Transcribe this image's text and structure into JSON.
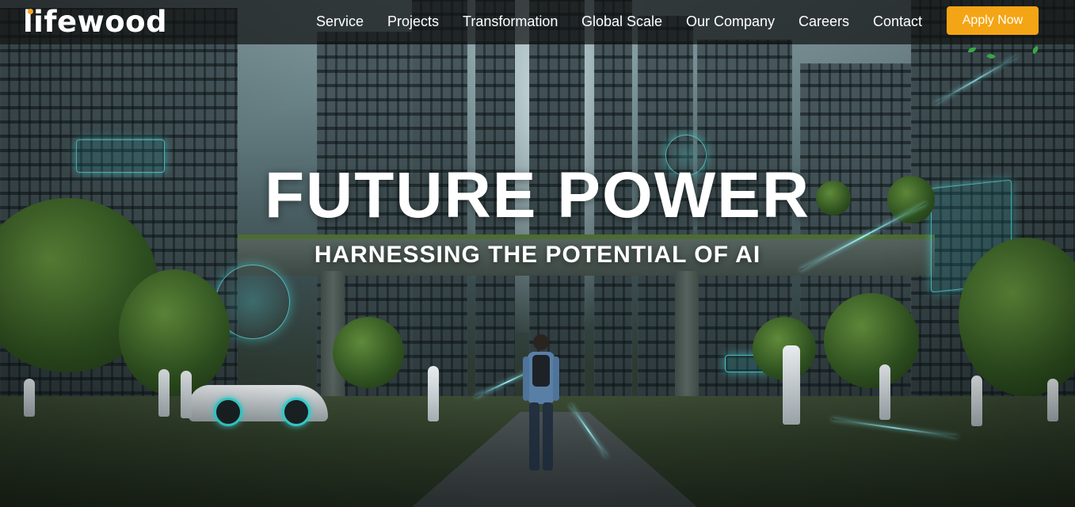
{
  "brand": {
    "logo_text": "lifewood",
    "accent_color": "#f6a623"
  },
  "nav": {
    "links": [
      {
        "label": "Service"
      },
      {
        "label": "Projects"
      },
      {
        "label": "Transformation"
      },
      {
        "label": "Global Scale"
      },
      {
        "label": "Our Company"
      },
      {
        "label": "Careers"
      },
      {
        "label": "Contact"
      }
    ],
    "cta": {
      "label": "Apply Now",
      "color": "#f4a515"
    }
  },
  "hero": {
    "title": "FUTURE POWER",
    "subtitle": "HARNESSING THE POTENTIAL OF AI",
    "background_icon": "futuristic-city-image"
  }
}
